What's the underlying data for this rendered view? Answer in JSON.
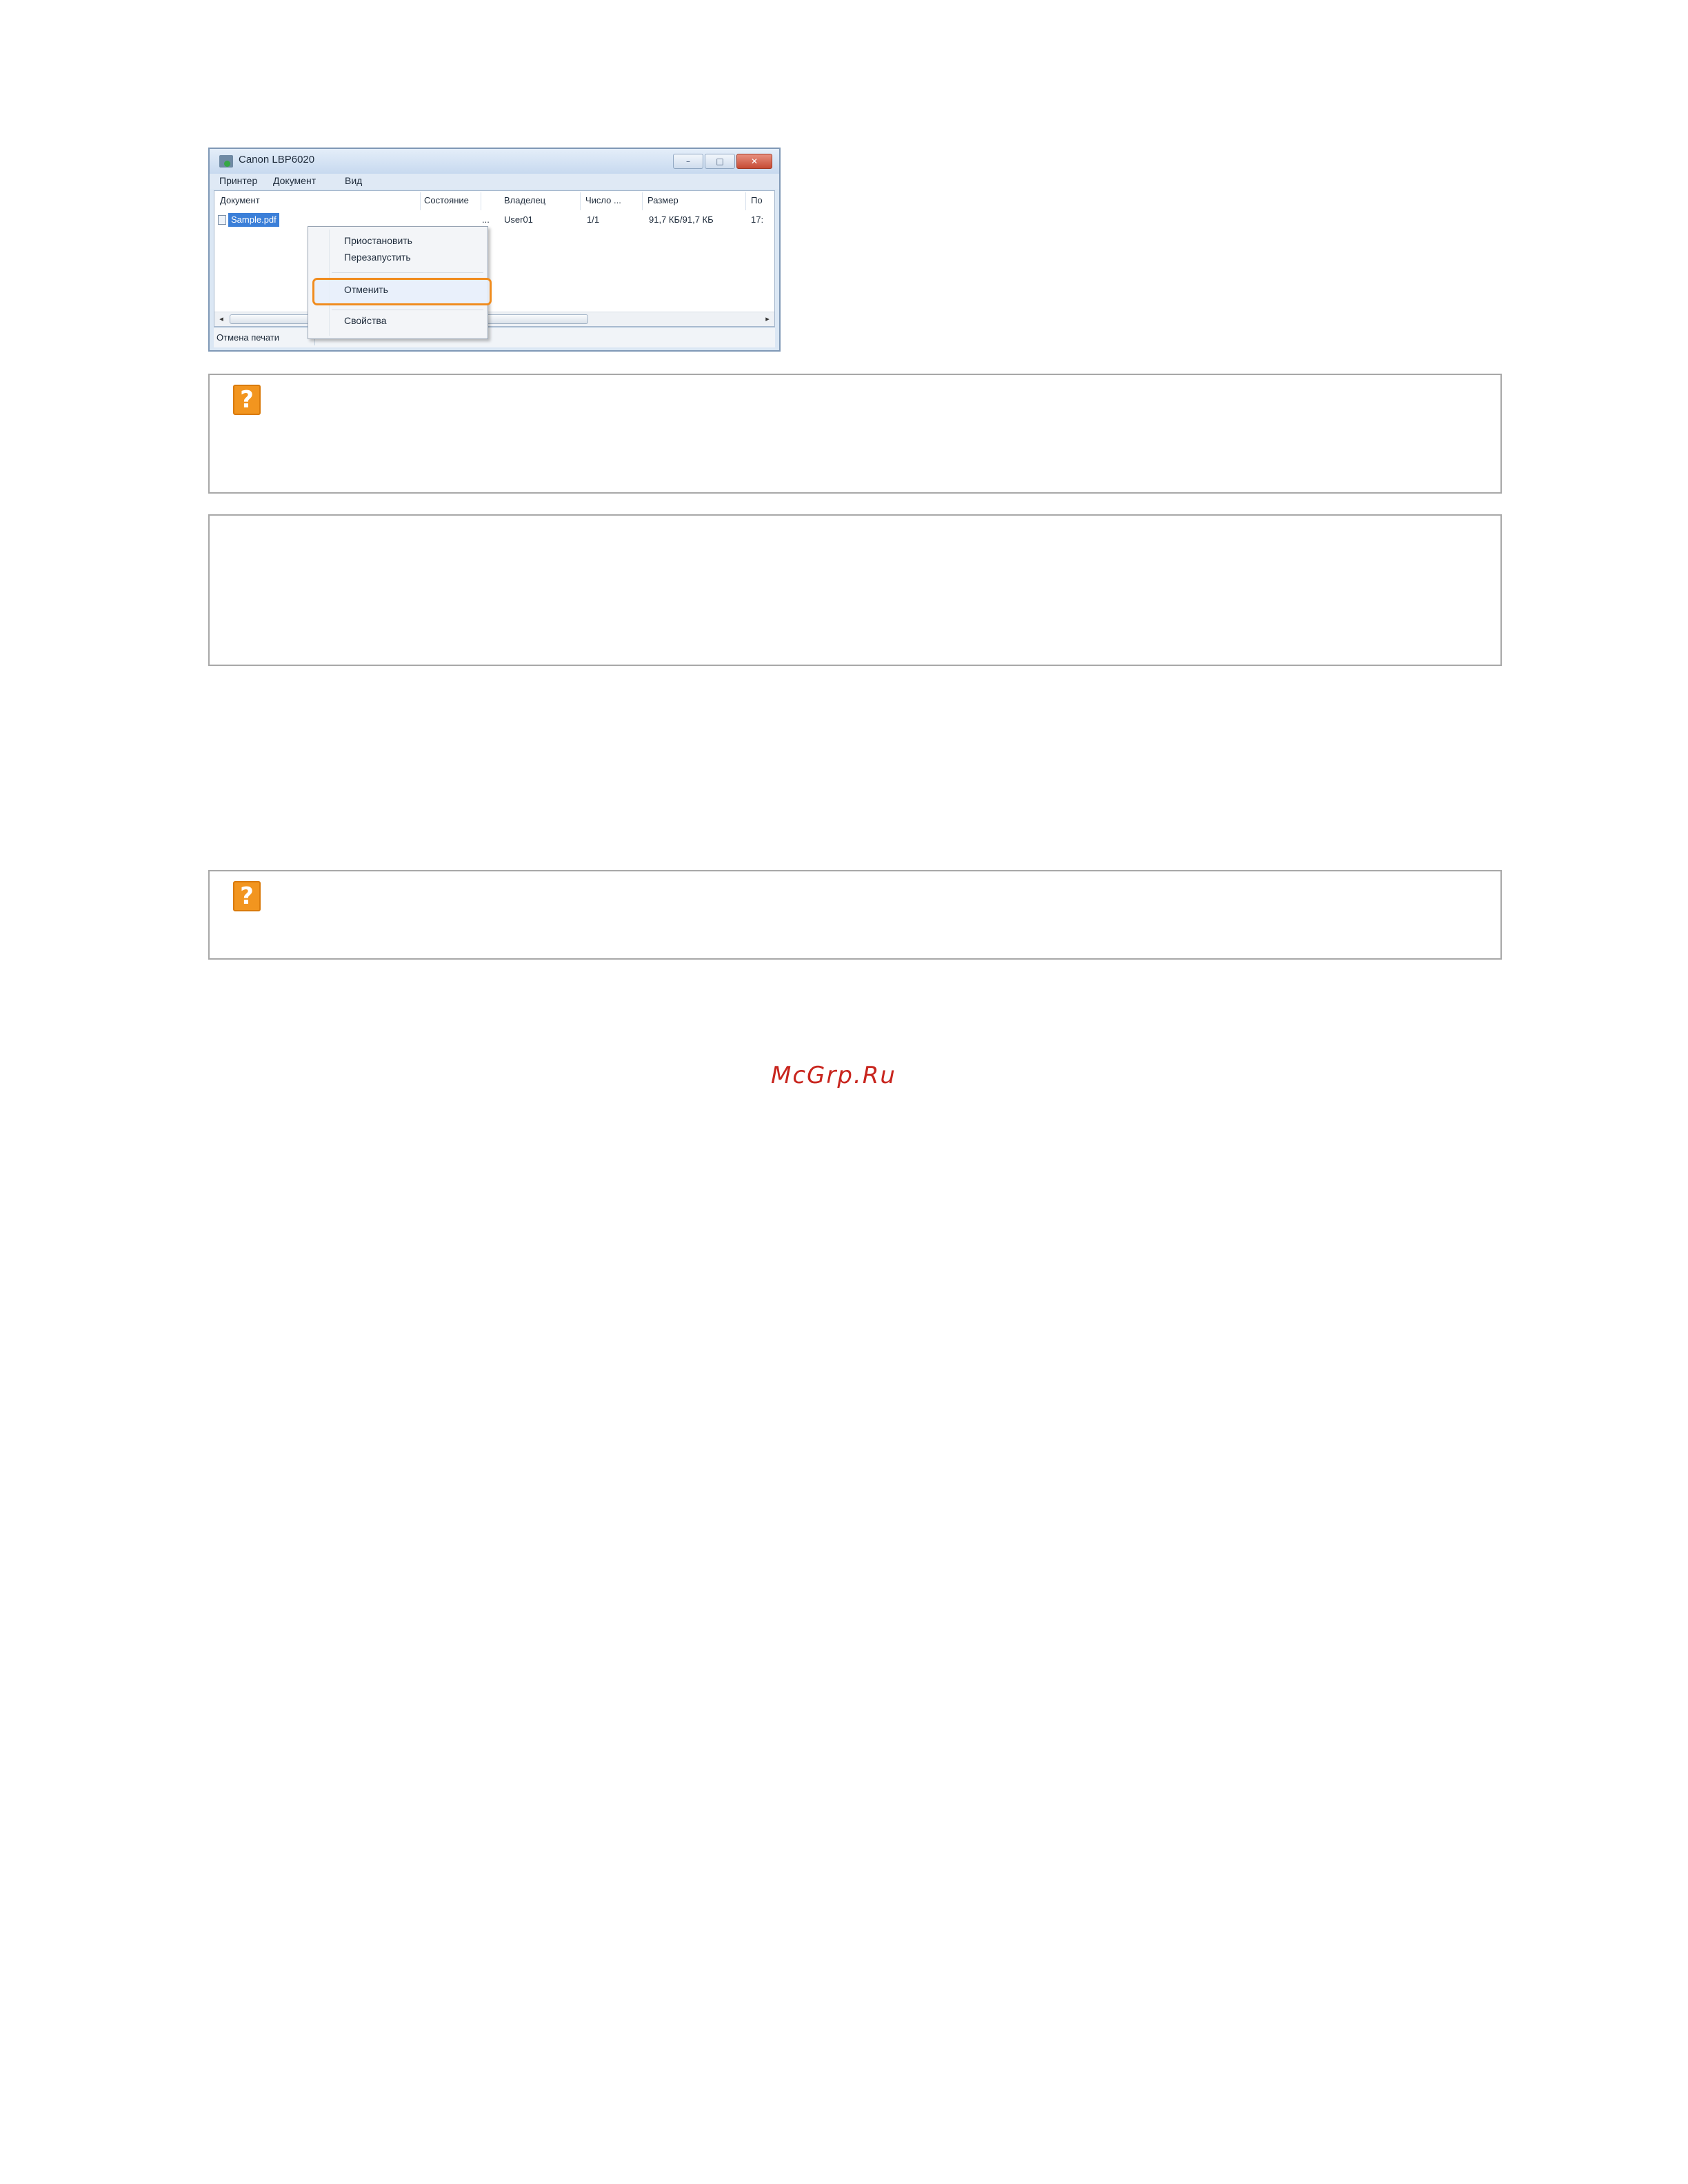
{
  "window": {
    "title": "Canon LBP6020",
    "controls": {
      "minimize": "–",
      "maximize": "□",
      "close": "✕"
    },
    "menu": [
      "Принтер",
      "Документ",
      "Вид"
    ],
    "columns": [
      "Документ",
      "Состояние",
      "Владелец",
      "Число ...",
      "Размер",
      "По"
    ],
    "job": {
      "document": "Sample.pdf",
      "status": "...",
      "owner": "User01",
      "pages": "1/1",
      "size": "91,7 КБ/91,7 КБ",
      "submitted": "17:"
    },
    "status_bar": "Отмена печати",
    "scroll": {
      "left_arrow": "◂",
      "right_arrow": "▸"
    }
  },
  "context_menu": {
    "items": [
      "Приостановить",
      "Перезапустить",
      "Отменить",
      "Свойства"
    ],
    "highlighted": "Отменить",
    "highlight_color": "#f08c1e"
  },
  "notes": [
    {
      "icon": "question-icon",
      "glyph": "?"
    },
    {
      "icon": "",
      "glyph": ""
    },
    {
      "icon": "question-icon",
      "glyph": "?"
    }
  ],
  "watermark": "McGrp.Ru"
}
